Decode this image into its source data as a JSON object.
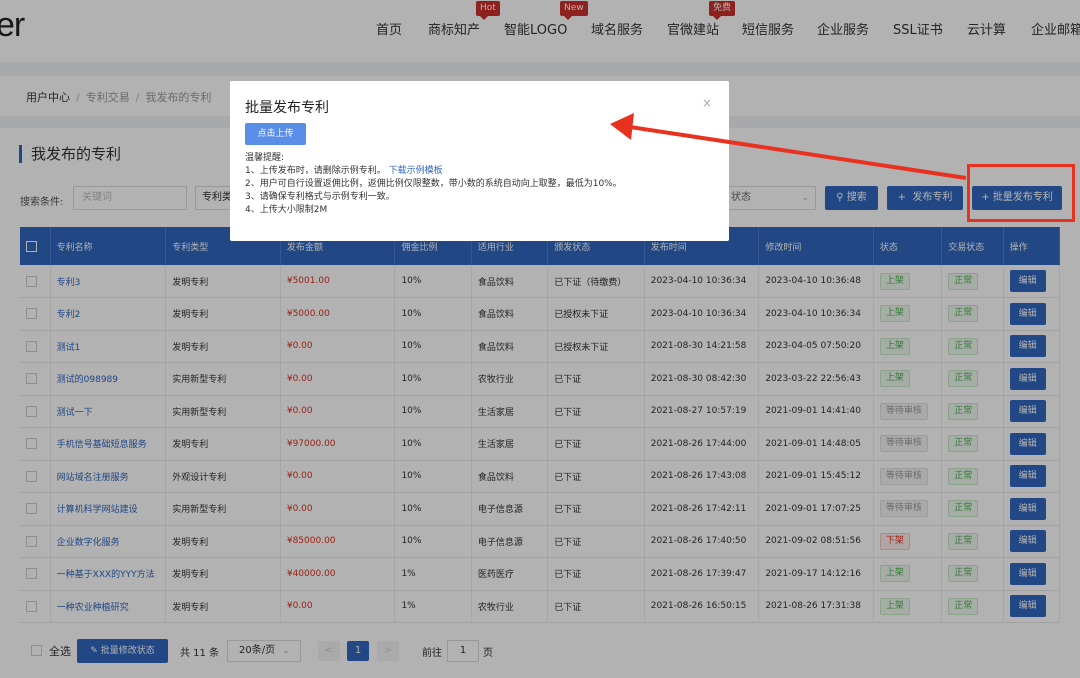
{
  "logo": {
    "text": "er"
  },
  "nav": {
    "items": [
      "首页",
      "商标知产",
      "智能LOGO",
      "域名服务",
      "官微建站",
      "短信服务",
      "企业服务",
      "SSL证书",
      "云计算",
      "企业邮箱"
    ],
    "badges": {
      "hot": "Hot",
      "new": "New",
      "free": "免费"
    }
  },
  "breadcrumb": [
    "用户中心",
    "专利交易",
    "我发布的专利"
  ],
  "page_title": "我发布的专利",
  "filter": {
    "label": "搜索条件:",
    "keyword_placeholder": "关键词",
    "type_value": "专利类",
    "status_value": "状态",
    "search_label": "搜索",
    "publish_label": "发布专利",
    "batch_publish_label": "批量发布专利"
  },
  "table": {
    "headers": [
      "专利名称",
      "专利类型",
      "发布金额",
      "佣金比例",
      "适用行业",
      "颁发状态",
      "发布时间",
      "修改时间",
      "状态",
      "交易状态",
      "操作"
    ],
    "rows": [
      {
        "name": "专利3",
        "type": "发明专利",
        "amount": "¥5001.00",
        "ratio": "10%",
        "industry": "食品饮料",
        "cert": "已下证（待缴费）",
        "published": "2023-04-10 10:36:34",
        "modified": "2023-04-10 10:36:48",
        "status": "上架",
        "trade": "正常",
        "action": "编辑"
      },
      {
        "name": "专利2",
        "type": "发明专利",
        "amount": "¥5000.00",
        "ratio": "10%",
        "industry": "食品饮料",
        "cert": "已授权未下证",
        "published": "2023-04-10 10:36:34",
        "modified": "2023-04-10 10:36:34",
        "status": "上架",
        "trade": "正常",
        "action": "编辑"
      },
      {
        "name": "测试1",
        "type": "发明专利",
        "amount": "¥0.00",
        "ratio": "10%",
        "industry": "食品饮料",
        "cert": "已授权未下证",
        "published": "2021-08-30 14:21:58",
        "modified": "2023-04-05 07:50:20",
        "status": "上架",
        "trade": "正常",
        "action": "编辑"
      },
      {
        "name": "测试的098989",
        "type": "实用新型专利",
        "amount": "¥0.00",
        "ratio": "10%",
        "industry": "农牧行业",
        "cert": "已下证",
        "published": "2021-08-30 08:42:30",
        "modified": "2023-03-22 22:56:43",
        "status": "上架",
        "trade": "正常",
        "action": "编辑"
      },
      {
        "name": "测试一下",
        "type": "实用新型专利",
        "amount": "¥0.00",
        "ratio": "10%",
        "industry": "生活家居",
        "cert": "已下证",
        "published": "2021-08-27 10:57:19",
        "modified": "2021-09-01 14:41:40",
        "status": "等待审核",
        "trade": "正常",
        "action": "编辑"
      },
      {
        "name": "手机信号基础短息服务",
        "type": "发明专利",
        "amount": "¥97000.00",
        "ratio": "10%",
        "industry": "生活家居",
        "cert": "已下证",
        "published": "2021-08-26 17:44:00",
        "modified": "2021-09-01 14:48:05",
        "status": "等待审核",
        "trade": "正常",
        "action": "编辑"
      },
      {
        "name": "网站域名注册服务",
        "type": "外观设计专利",
        "amount": "¥0.00",
        "ratio": "10%",
        "industry": "食品饮料",
        "cert": "已下证",
        "published": "2021-08-26 17:43:08",
        "modified": "2021-09-01 15:45:12",
        "status": "等待审核",
        "trade": "正常",
        "action": "编辑"
      },
      {
        "name": "计算机科学网站建设",
        "type": "实用新型专利",
        "amount": "¥0.00",
        "ratio": "10%",
        "industry": "电子信息源",
        "cert": "已下证",
        "published": "2021-08-26 17:42:11",
        "modified": "2021-09-01 17:07:25",
        "status": "等待审核",
        "trade": "正常",
        "action": "编辑"
      },
      {
        "name": "企业数字化服务",
        "type": "发明专利",
        "amount": "¥85000.00",
        "ratio": "10%",
        "industry": "电子信息源",
        "cert": "已下证",
        "published": "2021-08-26 17:40:50",
        "modified": "2021-09-02 08:51:56",
        "status": "下架",
        "trade": "正常",
        "action": "编辑"
      },
      {
        "name": "一种基于XXX的YYY方法",
        "type": "发明专利",
        "amount": "¥40000.00",
        "ratio": "1%",
        "industry": "医药医疗",
        "cert": "已下证",
        "published": "2021-08-26 17:39:47",
        "modified": "2021-09-17 14:12:16",
        "status": "上架",
        "trade": "正常",
        "action": "编辑"
      },
      {
        "name": "一种农业种植研究",
        "type": "发明专利",
        "amount": "¥0.00",
        "ratio": "1%",
        "industry": "农牧行业",
        "cert": "已下证",
        "published": "2021-08-26 16:50:15",
        "modified": "2021-08-26 17:31:38",
        "status": "上架",
        "trade": "正常",
        "action": "编辑"
      }
    ]
  },
  "footer": {
    "select_all": "全选",
    "batch_status": "批量修改状态",
    "total": "共 11 条",
    "page_size": "20条/页",
    "prev": "<",
    "current_page": "1",
    "next": ">",
    "goto_label": "前往",
    "goto_value": "1",
    "goto_suffix": "页"
  },
  "modal": {
    "title": "批量发布专利",
    "close": "×",
    "upload_label": "点击上传",
    "tips_title": "温馨提醒:",
    "tip1": "1、上传发布时，请删除示例专利。",
    "tip1_link": "下载示例模板",
    "tip2": "2、用户可自行设置返佣比例，返佣比例仅限整数，带小数的系统自动向上取整，最低为10%。",
    "tip3": "3、请确保专利格式与示例专利一致。",
    "tip4": "4、上传大小限制2M"
  },
  "colors": {
    "primary": "#3066be",
    "annotation": "#e8321f",
    "price": "#e0301e"
  }
}
